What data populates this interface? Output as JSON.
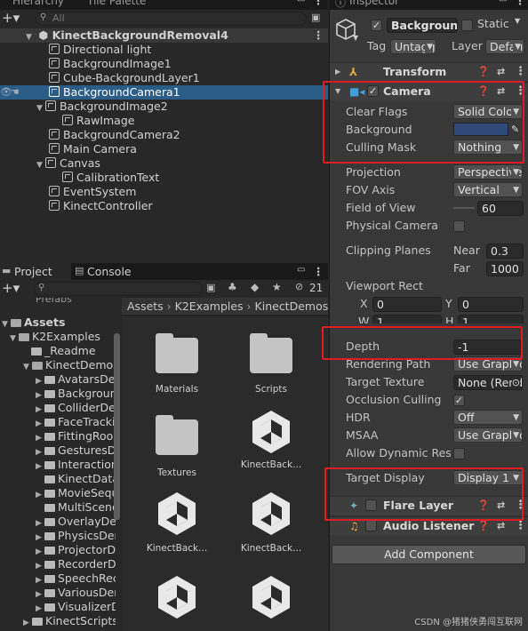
{
  "hierarchy": {
    "tab_label": "Hierarchy",
    "tab2_label": "Tile Palette",
    "search_placeholder": "All",
    "scene": "KinectBackgroundRemoval4",
    "items": [
      {
        "label": "Directional light"
      },
      {
        "label": "BackgroundImage1"
      },
      {
        "label": "Cube-BackgroundLayer1"
      },
      {
        "label": "BackgroundCamera1"
      },
      {
        "label": "BackgroundImage2"
      },
      {
        "label": "RawImage"
      },
      {
        "label": "BackgroundCamera2"
      },
      {
        "label": "Main Camera"
      },
      {
        "label": "Canvas"
      },
      {
        "label": "CalibrationText"
      },
      {
        "label": "EventSystem"
      },
      {
        "label": "KinectController"
      }
    ]
  },
  "project": {
    "tab_label": "Project",
    "console_label": "Console",
    "hidden_count": "21",
    "cut_item": "Prefabs",
    "breadcrumb": [
      "Assets",
      "K2Examples",
      "KinectDemos"
    ],
    "tree": [
      {
        "label": "Assets"
      },
      {
        "label": "K2Examples"
      },
      {
        "label": "_Readme"
      },
      {
        "label": "KinectDemos"
      },
      {
        "label": "AvatarsDemo"
      },
      {
        "label": "BackgroundRemovalDemo"
      },
      {
        "label": "ColliderDemo"
      },
      {
        "label": "FaceTrackingDemo"
      },
      {
        "label": "FittingRoomDemo"
      },
      {
        "label": "GesturesDemo"
      },
      {
        "label": "InteractionDemo"
      },
      {
        "label": "KinectDataServer"
      },
      {
        "label": "MovieSequenceDemo"
      },
      {
        "label": "MultiSceneDemo"
      },
      {
        "label": "OverlayDemo"
      },
      {
        "label": "PhysicsDemo"
      },
      {
        "label": "ProjectorDemo"
      },
      {
        "label": "RecorderDemo"
      },
      {
        "label": "SpeechRecognitionDemo"
      },
      {
        "label": "VariousDemos"
      },
      {
        "label": "VisualizerDemo"
      },
      {
        "label": "KinectScripts"
      }
    ],
    "grid": [
      {
        "label": "Materials",
        "kind": "folder"
      },
      {
        "label": "Scripts",
        "kind": "folder"
      },
      {
        "label": "Textures",
        "kind": "folder"
      },
      {
        "label": "KinectBack...",
        "kind": "unity"
      },
      {
        "label": "KinectBack...",
        "kind": "unity"
      },
      {
        "label": "KinectBack...",
        "kind": "unity"
      },
      {
        "label": "",
        "kind": "unity"
      },
      {
        "label": "",
        "kind": "unity"
      }
    ]
  },
  "inspector": {
    "tab_label": "Inspector",
    "object_name": "Background",
    "static_label": "Static",
    "tag_label": "Tag",
    "tag_value": "Untagged",
    "layer_label": "Layer",
    "layer_value": "Default",
    "transform_label": "Transform",
    "camera_label": "Camera",
    "camera_fields": {
      "clear_flags": {
        "label": "Clear Flags",
        "value": "Solid Color"
      },
      "background": {
        "label": "Background",
        "color": "#2f4a78"
      },
      "culling_mask": {
        "label": "Culling Mask",
        "value": "Nothing"
      },
      "projection": {
        "label": "Projection",
        "value": "Perspective"
      },
      "fov_axis": {
        "label": "FOV Axis",
        "value": "Vertical"
      },
      "fov": {
        "label": "Field of View",
        "value": "60"
      },
      "physical_camera": {
        "label": "Physical Camera"
      },
      "clipping": {
        "label": "Clipping Planes",
        "near_label": "Near",
        "near": "0.3",
        "far_label": "Far",
        "far": "1000"
      },
      "viewport": {
        "label": "Viewport Rect",
        "x": "0",
        "y": "0",
        "w": "1",
        "h": "1"
      },
      "depth": {
        "label": "Depth",
        "value": "-1"
      },
      "rendering_path": {
        "label": "Rendering Path",
        "value": "Use Graphics Settings"
      },
      "target_texture": {
        "label": "Target Texture",
        "value": "None (Render Texture)"
      },
      "occlusion": {
        "label": "Occlusion Culling"
      },
      "hdr": {
        "label": "HDR",
        "value": "Off"
      },
      "msaa": {
        "label": "MSAA",
        "value": "Use Graphics Settings"
      },
      "dynamic_res": {
        "label": "Allow Dynamic Resolution"
      },
      "target_display": {
        "label": "Target Display",
        "value": "Display 1"
      }
    },
    "flare_layer_label": "Flare Layer",
    "audio_listener_label": "Audio Listener",
    "add_component_label": "Add Component"
  },
  "watermark": "CSDN @猪猪侠勇闯互联网"
}
